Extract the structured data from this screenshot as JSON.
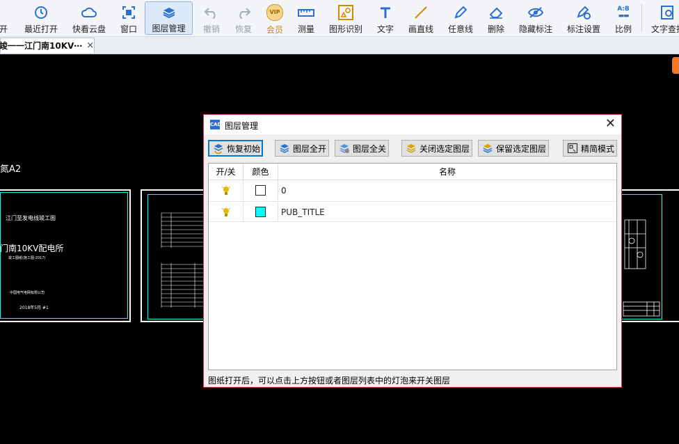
{
  "toolbar": {
    "items": [
      {
        "label": "开",
        "icon": "folder-open-icon"
      },
      {
        "label": "最近打开",
        "icon": "history-icon"
      },
      {
        "label": "快看云盘",
        "icon": "cloud-icon"
      },
      {
        "label": "窗口",
        "icon": "window-icon"
      },
      {
        "label": "图层管理",
        "icon": "layers-icon"
      },
      {
        "label": "撤销",
        "icon": "undo-icon"
      },
      {
        "label": "恢复",
        "icon": "redo-icon"
      },
      {
        "label": "会员",
        "icon": "vip-icon"
      },
      {
        "label": "测量",
        "icon": "ruler-icon"
      },
      {
        "label": "图形识别",
        "icon": "shape-recognize-icon"
      },
      {
        "label": "文字",
        "icon": "text-icon"
      },
      {
        "label": "画直线",
        "icon": "line-icon"
      },
      {
        "label": "任意线",
        "icon": "pen-icon"
      },
      {
        "label": "删除",
        "icon": "eraser-icon"
      },
      {
        "label": "隐藏标注",
        "icon": "eye-hide-icon"
      },
      {
        "label": "标注设置",
        "icon": "annotation-settings-icon"
      },
      {
        "label": "比例",
        "icon": "scale-icon"
      },
      {
        "label": "文字查找",
        "icon": "text-search-icon"
      }
    ],
    "vip_badge": "VIP",
    "scale_badge": "A:B"
  },
  "tab": {
    "title": "竣一一江门南10KV⋯",
    "close": "×"
  },
  "canvas": {
    "label_a2": "氮A2",
    "sheet1_title": "江门至发电线竣工图",
    "sheet1_main": "门南10KV配电所",
    "sheet1_sub": "竣工图纸(施工图-2017)",
    "sheet1_company": "中国电气电网有限公司",
    "sheet1_date": "2018年5月  #1"
  },
  "dialog": {
    "title": "图层管理",
    "logo_text": "CAD",
    "close": "✕",
    "buttons": {
      "restore": "恢复初始",
      "all_on": "图层全开",
      "all_off": "图层全关",
      "close_selected": "关闭选定图层",
      "keep_selected": "保留选定图层",
      "simple_mode": "精简模式"
    },
    "columns": {
      "toggle": "开/关",
      "color": "颜色",
      "name": "名称"
    },
    "layers": [
      {
        "on": true,
        "color": "#ffffff",
        "name": "0"
      },
      {
        "on": true,
        "color": "#00ffff",
        "name": "PUB_TITLE"
      }
    ],
    "status": "图纸打开后，可以点击上方按钮或者图层列表中的灯泡来开关图层"
  },
  "colors": {
    "accent": "#2a6fd1",
    "bulb": "#e6b800",
    "dialog_border": "#c23a4a"
  }
}
